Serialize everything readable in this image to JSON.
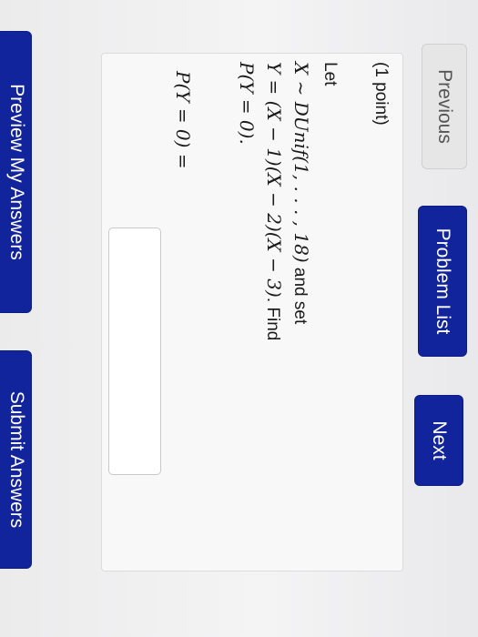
{
  "nav": {
    "previous_label": "Previous",
    "problem_list_label": "Problem List",
    "next_label": "Next"
  },
  "problem": {
    "points_label": "(1 point)",
    "intro_word": "Let",
    "line_x_def": "X ~ DUnif(1, . . . , 18)",
    "and_set": " and set",
    "line_y_def": "Y = (X − 1)(X − 2)(X − 3)",
    "find_text": ". Find",
    "target_expr": "P(Y = 0).",
    "answer_prompt": "P(Y = 0) =",
    "answer_value": ""
  },
  "footer": {
    "preview_label": "Preview My Answers",
    "submit_label": "Submit Answers"
  },
  "colors": {
    "primary_button": "#12249c",
    "secondary_button": "#e6e6e7",
    "panel_background": "#f8f8f9"
  }
}
